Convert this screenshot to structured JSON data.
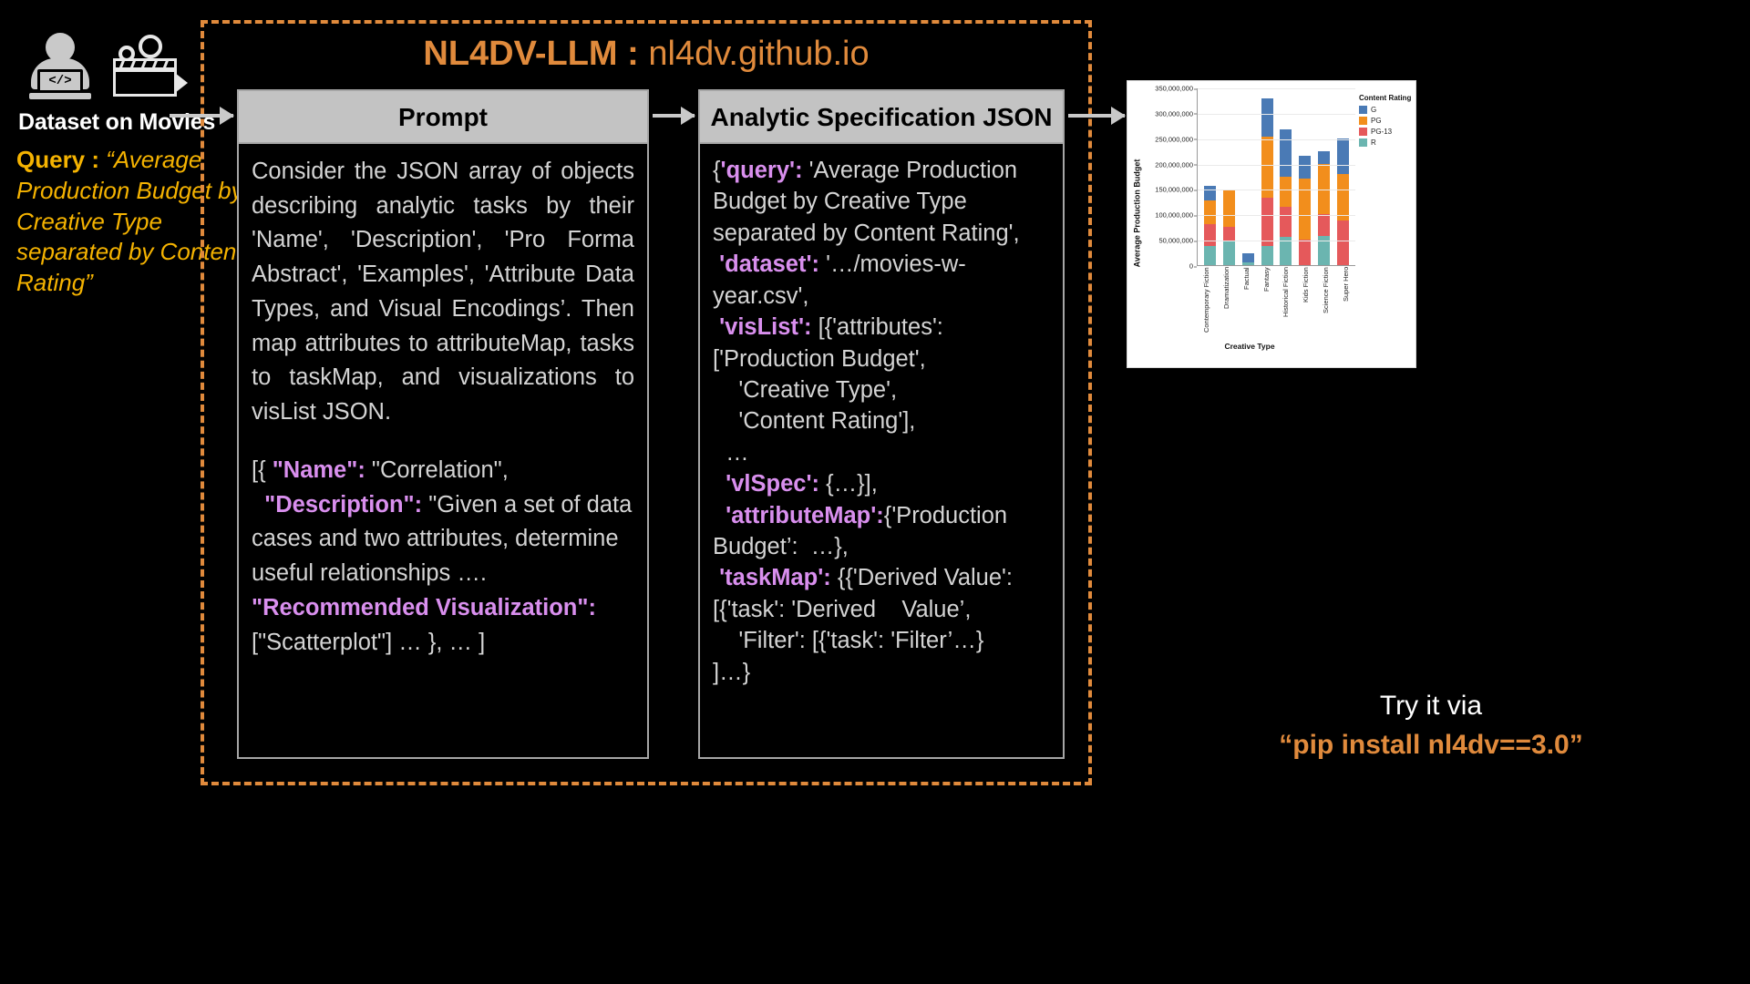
{
  "left": {
    "person_icon": "person-coding-icon",
    "movie_icon": "movie-clapperboard-camera-icon",
    "code_glyph": "</>",
    "dataset_label": "Dataset on Movies",
    "query_prefix": "Query : ",
    "query_text": "“Average Production Budget by Creative Type separated by Content Rating”"
  },
  "title": {
    "bold": "NL4DV-LLM",
    "separator": " : ",
    "plain": "nl4dv.github.io",
    "color": "#e08a3c"
  },
  "prompt_panel": {
    "header": "Prompt",
    "paragraph1": "Consider the JSON array of objects describing analytic tasks by their 'Name', 'Description', 'Pro Forma Abstract', 'Examples', 'Attribute Data Types, and Visual Encodings’. Then map attributes to attributeMap, tasks to taskMap, and visualizations to visList JSON.",
    "line_open": "[{ ",
    "kw_name": "\"Name\":",
    "val_name": " \"Correlation\",",
    "kw_description": "\"Description\":",
    "val_description": " \"Given a set of data cases and two attributes, determine useful relationships ….",
    "kw_recommended": "\"Recommended Visualization\":",
    "val_recommended": "[\"Scatterplot\"] … }, … ]"
  },
  "json_panel": {
    "header": "Analytic Specification JSON",
    "open_brace": "{",
    "kw_query": "'query':",
    "val_query": " 'Average Production Budget by Creative Type separated by Content Rating',",
    "kw_dataset": " 'dataset':",
    "val_dataset": " '…/movies-w-year.csv',",
    "kw_vislist": " 'visList':",
    "val_vislist": " [{'attributes': ['Production Budget',",
    "val_vislist2": "    'Creative Type',",
    "val_vislist3": "    'Content Rating'],",
    "ellipsis": "  …",
    "kw_vlspec": "  'vlSpec':",
    "val_vlspec": " {…}],",
    "kw_attributemap": "  'attributeMap':",
    "val_attributemap": "{'Production Budget’:  …},",
    "kw_taskmap": " 'taskMap':",
    "val_taskmap": " {{'Derived Value': [{'task': 'Derived    Value’,",
    "val_taskmap2": "    'Filter': [{'task': 'Filter’…}",
    "val_taskmap3": "]…}"
  },
  "chart_data": {
    "type": "bar",
    "stacked": true,
    "title": "",
    "xlabel": "Creative Type",
    "ylabel": "Average Production Budget",
    "ylim": [
      0,
      350000000
    ],
    "yticks": [
      0,
      50000000,
      100000000,
      150000000,
      200000000,
      250000000,
      300000000,
      350000000
    ],
    "ytick_labels": [
      "0",
      "50,000,000",
      "100,000,000",
      "150,000,000",
      "200,000,000",
      "250,000,000",
      "300,000,000",
      "350,000,000"
    ],
    "grid": true,
    "legend_title": "Content Rating",
    "legend_position": "right",
    "categories": [
      "Contemporary Fiction",
      "Dramatization",
      "Factual",
      "Fantasy",
      "Historical Fiction",
      "Kids Fiction",
      "Science Fiction",
      "Super Hero"
    ],
    "series": [
      {
        "name": "R",
        "color": "#6bb5b0",
        "values": [
          37000000,
          48000000,
          5000000,
          37000000,
          55000000,
          0,
          58000000,
          0
        ]
      },
      {
        "name": "PG-13",
        "color": "#e5595b",
        "values": [
          43000000,
          28000000,
          0,
          96000000,
          60000000,
          50000000,
          42000000,
          88000000
        ]
      },
      {
        "name": "PG",
        "color": "#f28e1c",
        "values": [
          47000000,
          71000000,
          0,
          120000000,
          60000000,
          120000000,
          100000000,
          92000000
        ]
      },
      {
        "name": "G",
        "color": "#4a7ab5",
        "values": [
          30000000,
          0,
          18000000,
          75000000,
          93000000,
          45000000,
          25000000,
          70000000
        ]
      }
    ]
  },
  "footer": {
    "line1": "Try it via",
    "line2": "“pip install nl4dv==3.0”"
  }
}
